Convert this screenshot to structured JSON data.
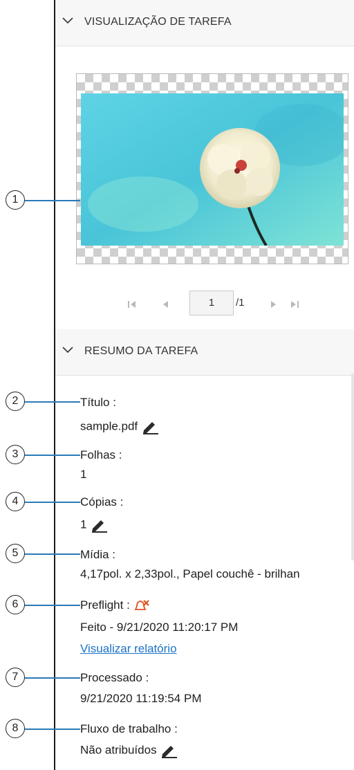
{
  "preview_section": {
    "title": "VISUALIZAÇÃO DE TAREFA"
  },
  "pager": {
    "current_page": "1",
    "total_pages": "/1"
  },
  "summary_section": {
    "title": "RESUMO DA TAREFA"
  },
  "fields": {
    "title": {
      "label": "Título :",
      "value": "sample.pdf"
    },
    "sheets": {
      "label": "Folhas :",
      "value": "1"
    },
    "copies": {
      "label": "Cópias :",
      "value": "1"
    },
    "media": {
      "label": "Mídia :",
      "value": "4,17pol. x 2,33pol., Papel couchê - brilhan"
    },
    "preflight": {
      "label": "Preflight :",
      "value": "Feito - 9/21/2020 11:20:17 PM",
      "link": "Visualizar relatório"
    },
    "processed": {
      "label": "Processado :",
      "value": "9/21/2020 11:19:54 PM"
    },
    "workflow": {
      "label": "Fluxo de trabalho :",
      "value": "Não atribuídos"
    }
  },
  "callouts": [
    "1",
    "2",
    "3",
    "4",
    "5",
    "6",
    "7",
    "8"
  ],
  "colors": {
    "accent_link": "#1a73c8",
    "leader_line": "#2a7ab8",
    "preflight_alert": "#e0501e"
  },
  "icons": [
    "chevron-down-icon",
    "first-page-icon",
    "prev-page-icon",
    "next-page-icon",
    "last-page-icon",
    "pencil-icon",
    "preflight-alert-icon"
  ]
}
